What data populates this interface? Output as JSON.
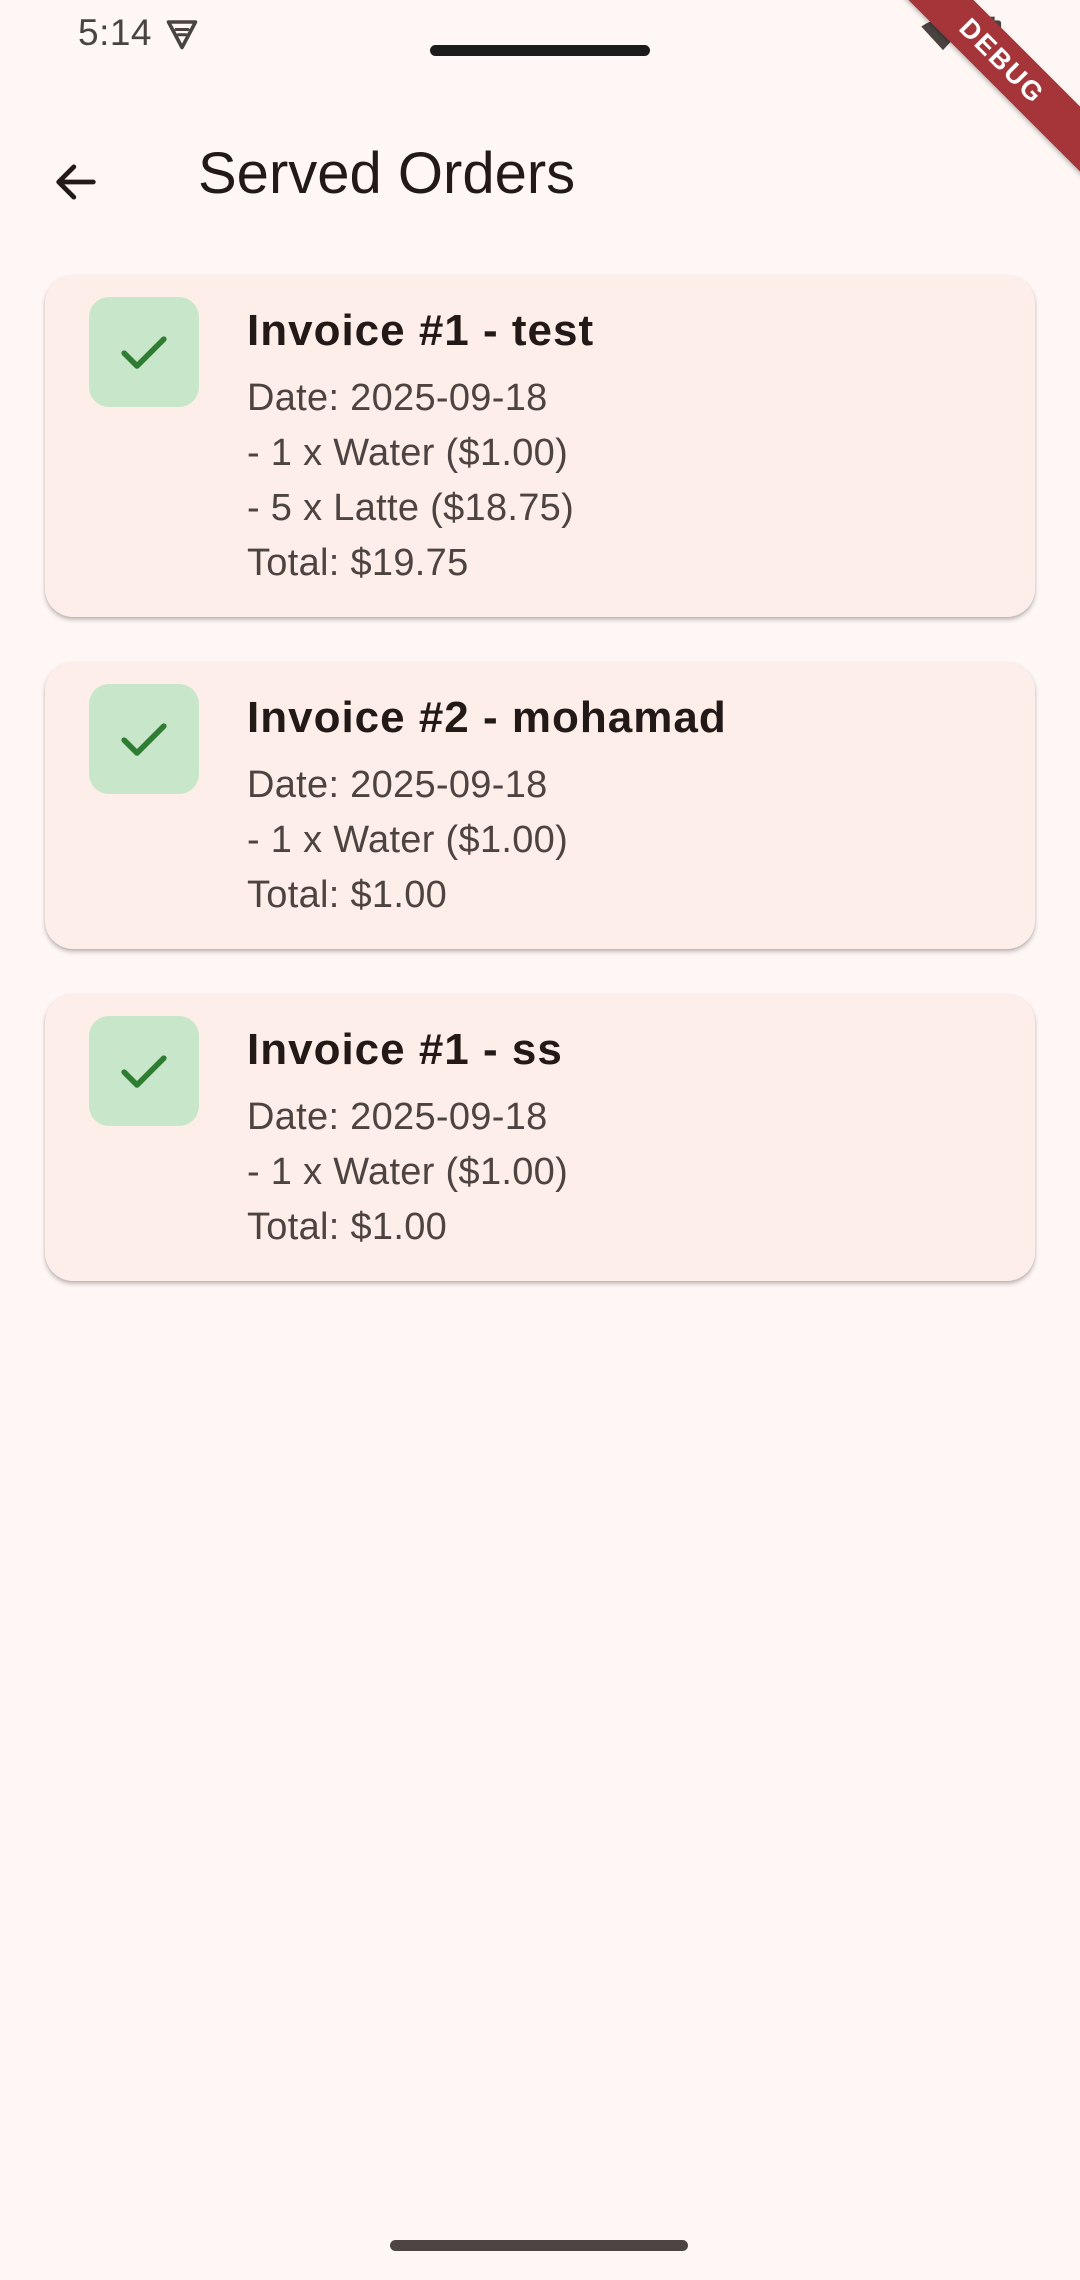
{
  "status_bar": {
    "time": "5:14"
  },
  "debug_banner": "DEBUG",
  "app_bar": {
    "title": "Served Orders"
  },
  "colors": {
    "background": "#fff7f5",
    "card": "#fdeeea",
    "check_badge": "#c8e6c9",
    "check_mark": "#2e7d32",
    "debug_ribbon": "#a6353a"
  },
  "orders": [
    {
      "title": "Invoice #1 - test",
      "date": "Date: 2025-09-18",
      "items": [
        "- 1 x Water ($1.00)",
        "- 5 x Latte ($18.75)"
      ],
      "total": "Total: $19.75"
    },
    {
      "title": "Invoice #2 - mohamad",
      "date": "Date: 2025-09-18",
      "items": [
        "- 1 x Water ($1.00)"
      ],
      "total": "Total: $1.00"
    },
    {
      "title": "Invoice #1 - ss",
      "date": "Date: 2025-09-18",
      "items": [
        "- 1 x Water ($1.00)"
      ],
      "total": "Total: $1.00"
    }
  ]
}
